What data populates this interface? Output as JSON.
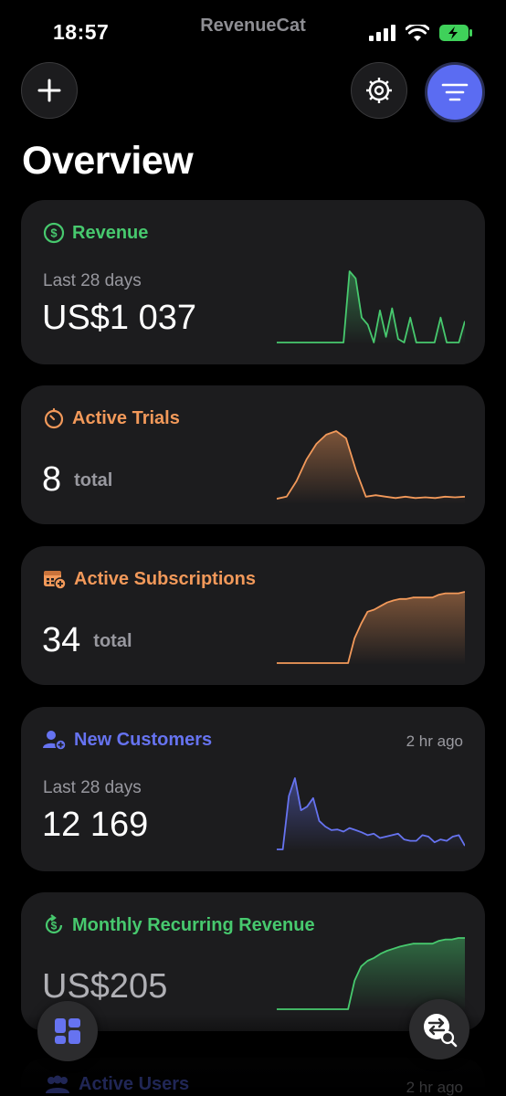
{
  "status_bar": {
    "time": "18:57",
    "brand": "RevenueCat",
    "icons": [
      "cellular-signal-icon",
      "wifi-icon",
      "battery-charging-icon"
    ]
  },
  "toolbar": {
    "add_icon": "plus-icon",
    "settings_icon": "gear-icon",
    "filter_icon": "filter-lines-icon"
  },
  "page": {
    "title": "Overview"
  },
  "colors": {
    "green": "#47c96e",
    "orange": "#f2995a",
    "blue": "#6673f0",
    "card": "#1c1c1e",
    "muted": "#98989f"
  },
  "cards": [
    {
      "title": "Revenue",
      "icon": "dollar-circle-icon",
      "color": "#47c96e",
      "subtitle": "Last 28 days",
      "value": "US$1 037",
      "unit": "",
      "meta": "",
      "sparkline": [
        0,
        0,
        0,
        0,
        0,
        0,
        0,
        0,
        0,
        0,
        0,
        0,
        100,
        90,
        35,
        25,
        0,
        45,
        8,
        48,
        5,
        0,
        35,
        0,
        0,
        0,
        0,
        35,
        0,
        0,
        0,
        30
      ]
    },
    {
      "title": "Active Trials",
      "icon": "timer-icon",
      "color": "#f2995a",
      "subtitle": "",
      "value": "8",
      "unit": "total",
      "meta": "",
      "sparkline": [
        5,
        8,
        30,
        60,
        82,
        95,
        100,
        90,
        45,
        8,
        10,
        8,
        6,
        8,
        6,
        7,
        6,
        8,
        7,
        8
      ]
    },
    {
      "title": "Active Subscriptions",
      "icon": "calendar-add-icon",
      "color": "#f2995a",
      "subtitle": "",
      "value": "34",
      "unit": "total",
      "meta": "",
      "sparkline": [
        0,
        0,
        0,
        0,
        0,
        0,
        0,
        0,
        0,
        0,
        0,
        0,
        35,
        55,
        72,
        75,
        80,
        85,
        88,
        90,
        90,
        92,
        92,
        92,
        92,
        96,
        98,
        98,
        98,
        100
      ]
    },
    {
      "title": "New Customers",
      "icon": "user-add-icon",
      "color": "#6673f0",
      "subtitle": "Last 28 days",
      "value": "12 169",
      "unit": "",
      "meta": "2 hr ago",
      "sparkline": [
        0,
        0,
        75,
        100,
        55,
        60,
        72,
        40,
        32,
        27,
        28,
        25,
        30,
        27,
        24,
        20,
        22,
        16,
        18,
        20,
        22,
        14,
        12,
        12,
        20,
        18,
        10,
        14,
        12,
        18,
        20,
        5
      ]
    },
    {
      "title": "Monthly Recurring Revenue",
      "icon": "dollar-refresh-icon",
      "color": "#47c96e",
      "subtitle": "",
      "value": "US$205",
      "unit": "",
      "meta": "",
      "sparkline": [
        0,
        0,
        0,
        0,
        0,
        0,
        0,
        0,
        0,
        0,
        0,
        0,
        40,
        60,
        68,
        72,
        78,
        82,
        85,
        88,
        90,
        92,
        92,
        92,
        92,
        96,
        98,
        98,
        100,
        100
      ]
    }
  ],
  "ghost_card": {
    "title": "Active Users",
    "icon": "users-icon",
    "meta": "2 hr ago"
  },
  "floating": {
    "dashboard_icon": "dashboard-grid-icon",
    "switch_icon": "switch-search-icon"
  }
}
